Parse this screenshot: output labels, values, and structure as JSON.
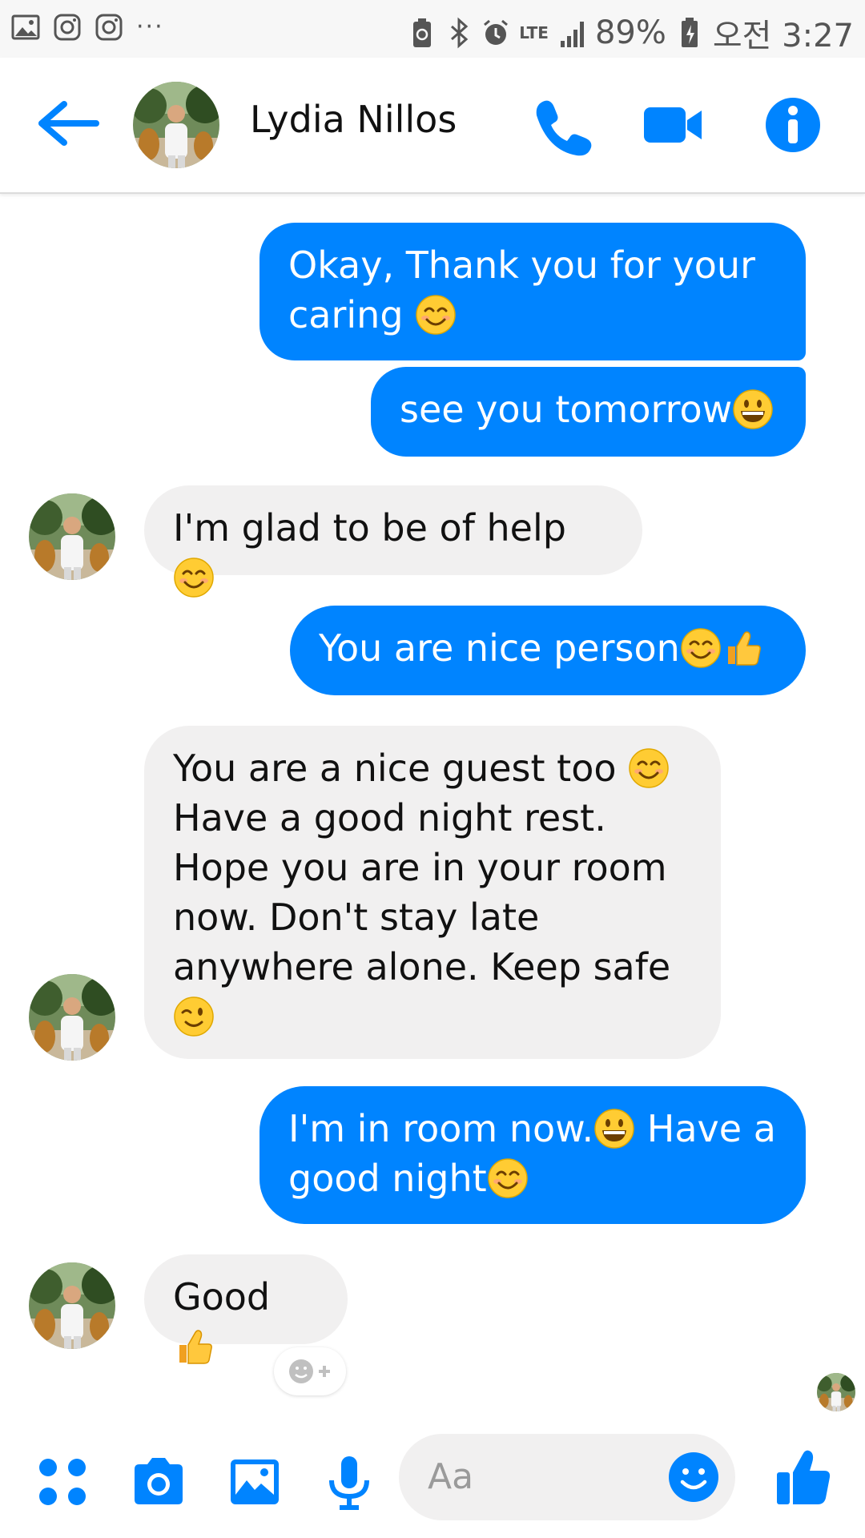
{
  "status_bar": {
    "battery": "89%",
    "network": "LTE",
    "time": "오전 3:27",
    "more": "···"
  },
  "header": {
    "contact_name": "Lydia Nillos"
  },
  "messages": [
    {
      "side": "out",
      "text": "Okay, Thank you for your caring"
    },
    {
      "side": "out",
      "text": "see you tomorrow"
    },
    {
      "side": "in",
      "text": "I'm glad to be of help"
    },
    {
      "side": "out",
      "text": "You are nice person"
    },
    {
      "side": "in",
      "text": "You are a nice guest too",
      "lines": [
        "Have a good night rest.",
        "Hope you are in your room",
        "now. Don't stay late",
        "anywhere alone. Keep safe"
      ]
    },
    {
      "side": "out",
      "text": "I'm in room now.",
      "text2": "Have a",
      "text3": "good night"
    },
    {
      "side": "in",
      "text": "Good"
    }
  ],
  "composer": {
    "placeholder": "Aa"
  },
  "colors": {
    "accent": "#0084ff",
    "incoming_bubble": "#f1f0f0"
  },
  "icons": [
    "gallery-icon",
    "instagram-icon",
    "back-arrow-icon",
    "phone-icon",
    "video-camera-icon",
    "info-icon",
    "more-apps-icon",
    "camera-icon",
    "image-icon",
    "microphone-icon",
    "emoji-icon",
    "thumbs-up-icon",
    "add-reaction-icon"
  ]
}
